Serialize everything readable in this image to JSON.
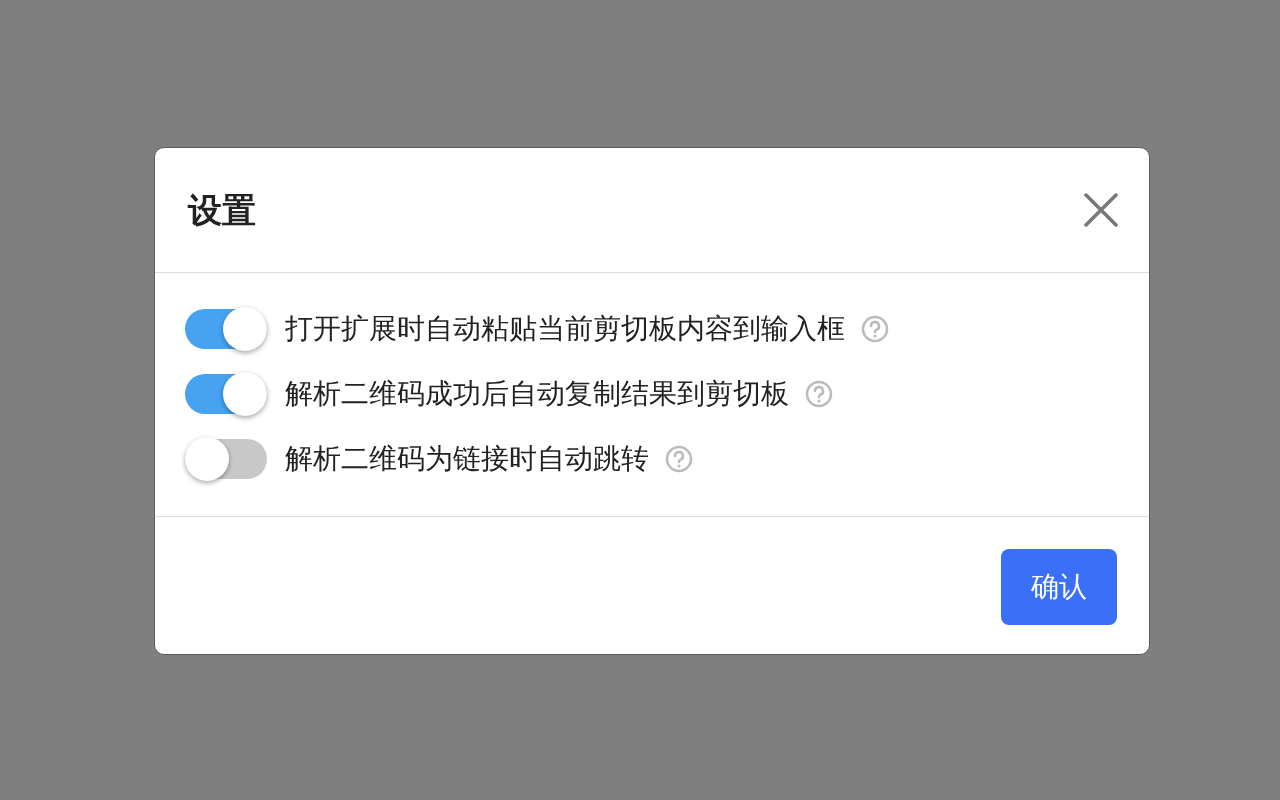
{
  "dialog": {
    "title": "设置",
    "options": [
      {
        "label": "打开扩展时自动粘贴当前剪切板内容到输入框",
        "on": true
      },
      {
        "label": "解析二维码成功后自动复制结果到剪切板",
        "on": true
      },
      {
        "label": "解析二维码为链接时自动跳转",
        "on": false
      }
    ],
    "confirm_button": "确认"
  }
}
